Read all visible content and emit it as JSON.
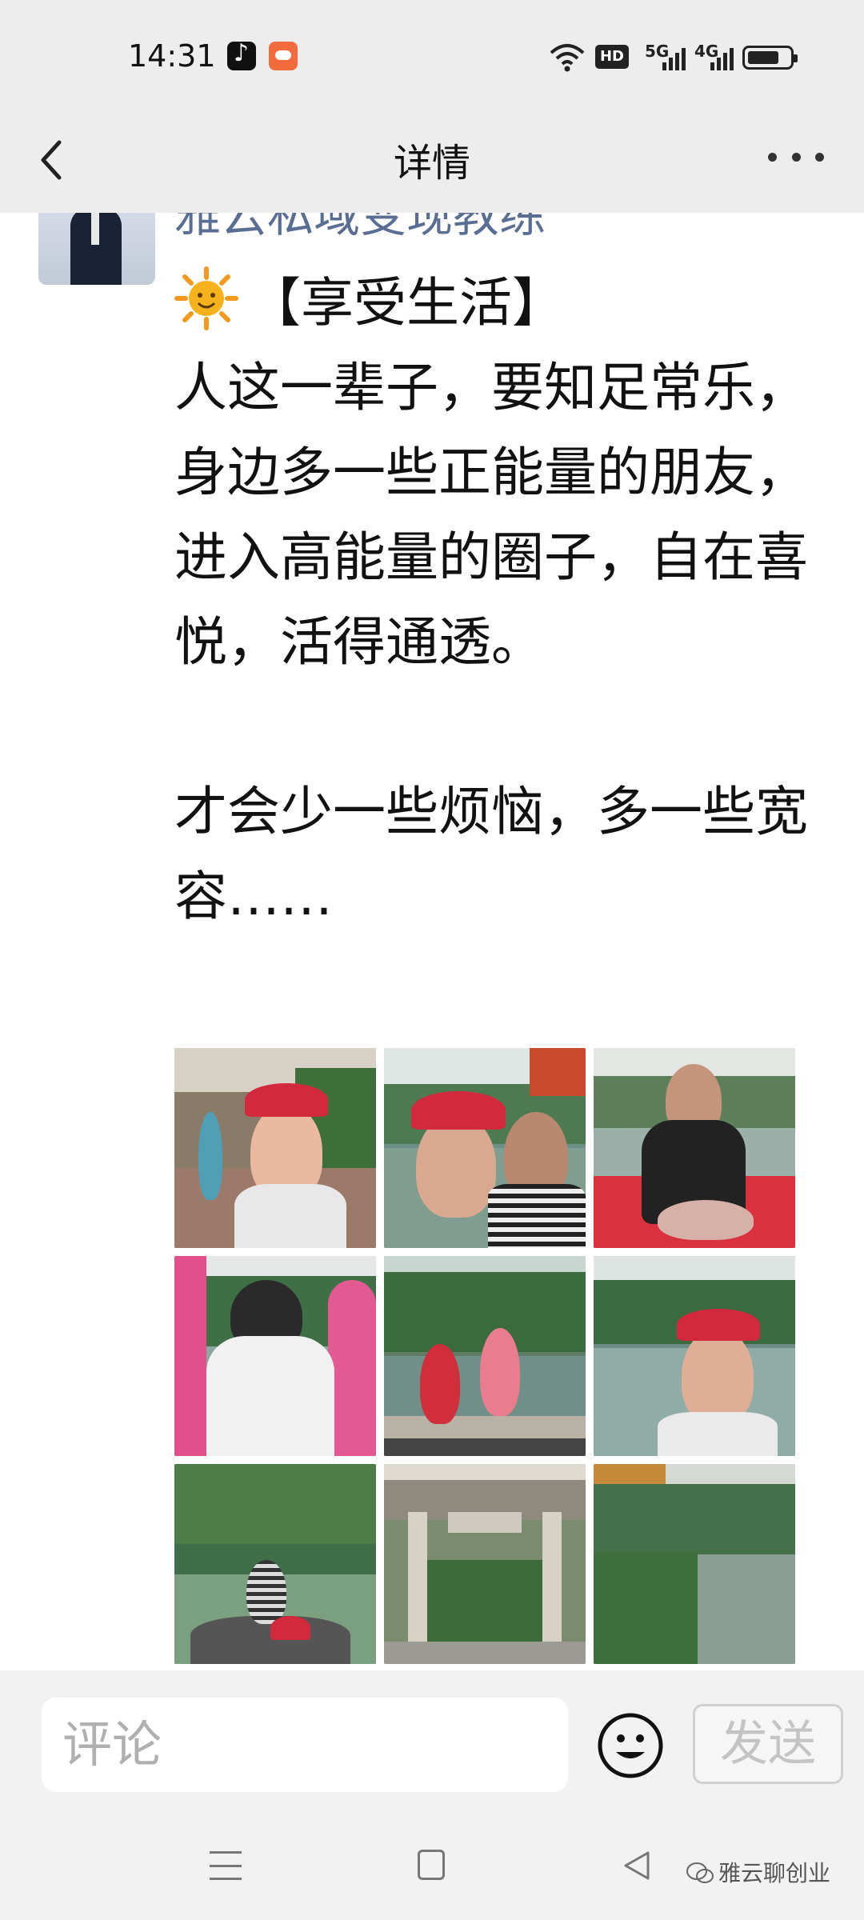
{
  "status_bar": {
    "time": "14:31",
    "icons": [
      "tiktok-icon",
      "game-icon",
      "wifi-icon",
      "hd-icon",
      "5g-signal-icon",
      "4g-signal-icon",
      "battery-icon"
    ],
    "hd": "HD",
    "net1": "5G",
    "net2": "4G"
  },
  "nav": {
    "title": "详情"
  },
  "post": {
    "author": "雅云私域变现教练",
    "text": "【享受生活】\n人这一辈子，要知足常乐，身边多一些正能量的朋友，进入高能量的圈子，自在喜悦，活得通透。\n\n才会少一些烦恼，多一些宽容……",
    "photo_count": 9
  },
  "comment": {
    "placeholder": "评论",
    "send_label": "发送"
  },
  "watermark": "雅云聊创业",
  "colors": {
    "status_bg": "#ededed",
    "author": "#5a6d93",
    "text": "#111111",
    "comment_bg": "#f2f2f2"
  }
}
